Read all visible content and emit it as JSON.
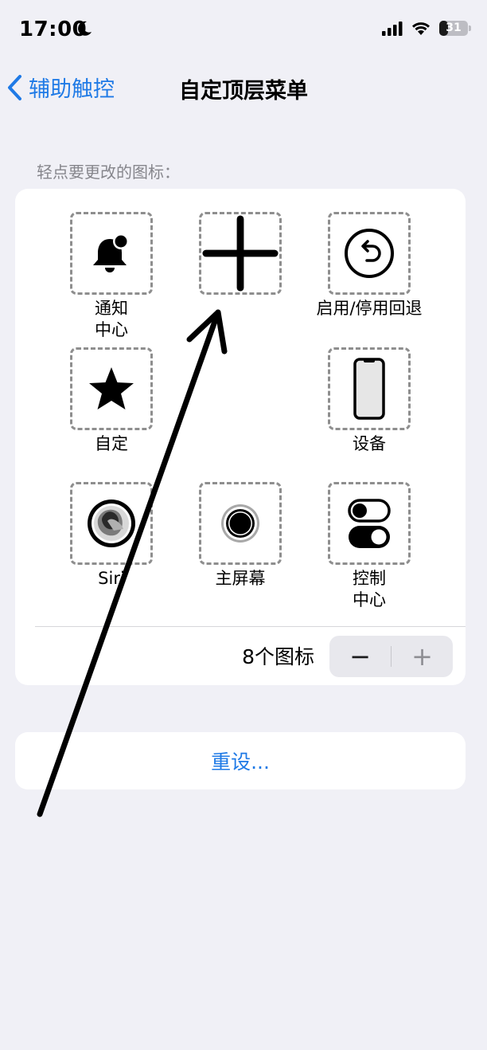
{
  "status": {
    "time": "17:00",
    "battery": "31",
    "battery_level_percent": 31,
    "icons": [
      "moon-icon",
      "cellular-signal-icon",
      "wifi-icon",
      "battery-icon"
    ]
  },
  "nav": {
    "back_label": "辅助触控",
    "title": "自定顶层菜单",
    "accent_color": "#1f7ae6"
  },
  "section_header": "轻点要更改的图标：",
  "grid": {
    "notification_center": {
      "label": "通知\n中心",
      "icon": "bell-badge-icon"
    },
    "add": {
      "label": "",
      "icon": "plus-icon"
    },
    "back_toggle": {
      "label": "启用/停用回退",
      "icon": "undo-circle-icon"
    },
    "custom": {
      "label": "自定",
      "icon": "star-icon"
    },
    "device": {
      "label": "设备",
      "icon": "iphone-icon"
    },
    "siri": {
      "label": "Siri",
      "icon": "siri-orb-icon"
    },
    "home": {
      "label": "主屏幕",
      "icon": "home-button-icon"
    },
    "control_center": {
      "label": "控制\n中心",
      "icon": "toggles-icon"
    }
  },
  "icon_count": {
    "label": "8个图标",
    "minus": "−",
    "plus": "+"
  },
  "reset": {
    "label": "重设..."
  },
  "annotation": {
    "type": "hand-drawn-arrow",
    "color": "#000000"
  }
}
